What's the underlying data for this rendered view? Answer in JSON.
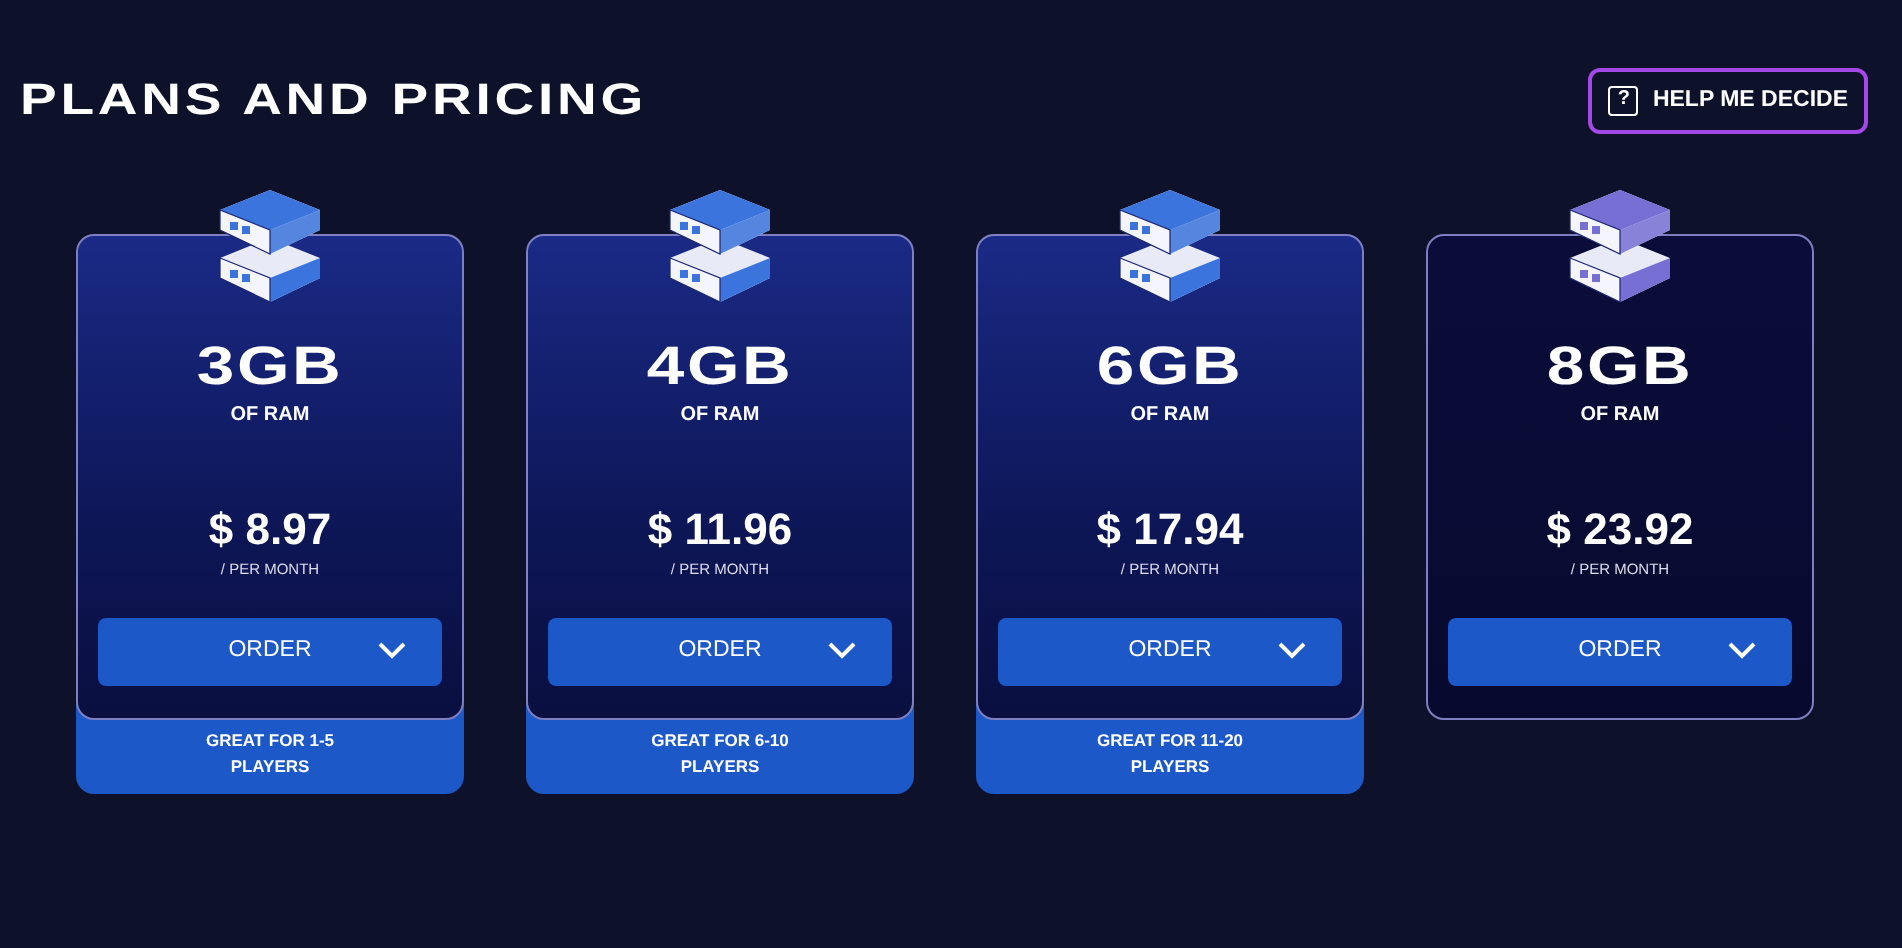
{
  "title": "PLANS AND PRICING",
  "help_button": {
    "label": "HELP ME DECIDE",
    "icon_glyph": "?"
  },
  "plans": [
    {
      "ram": "3GB",
      "ram_label": "OF RAM",
      "price": "$ 8.97",
      "period": "/ PER MONTH",
      "order_label": "ORDER",
      "color": "#3a74dc",
      "tagline": "GREAT FOR 1-5 PLAYERS"
    },
    {
      "ram": "4GB",
      "ram_label": "OF RAM",
      "price": "$ 11.96",
      "period": "/ PER MONTH",
      "order_label": "ORDER",
      "color": "#3a74dc",
      "tagline": "GREAT FOR 6-10 PLAYERS"
    },
    {
      "ram": "6GB",
      "ram_label": "OF RAM",
      "price": "$ 17.94",
      "period": "/ PER MONTH",
      "order_label": "ORDER",
      "color": "#3a74dc",
      "tagline": "GREAT FOR 11-20 PLAYERS"
    },
    {
      "ram": "8GB",
      "ram_label": "OF RAM",
      "price": "$ 23.92",
      "period": "/ PER MONTH",
      "order_label": "ORDER",
      "color": "#7770d4"
    }
  ]
}
